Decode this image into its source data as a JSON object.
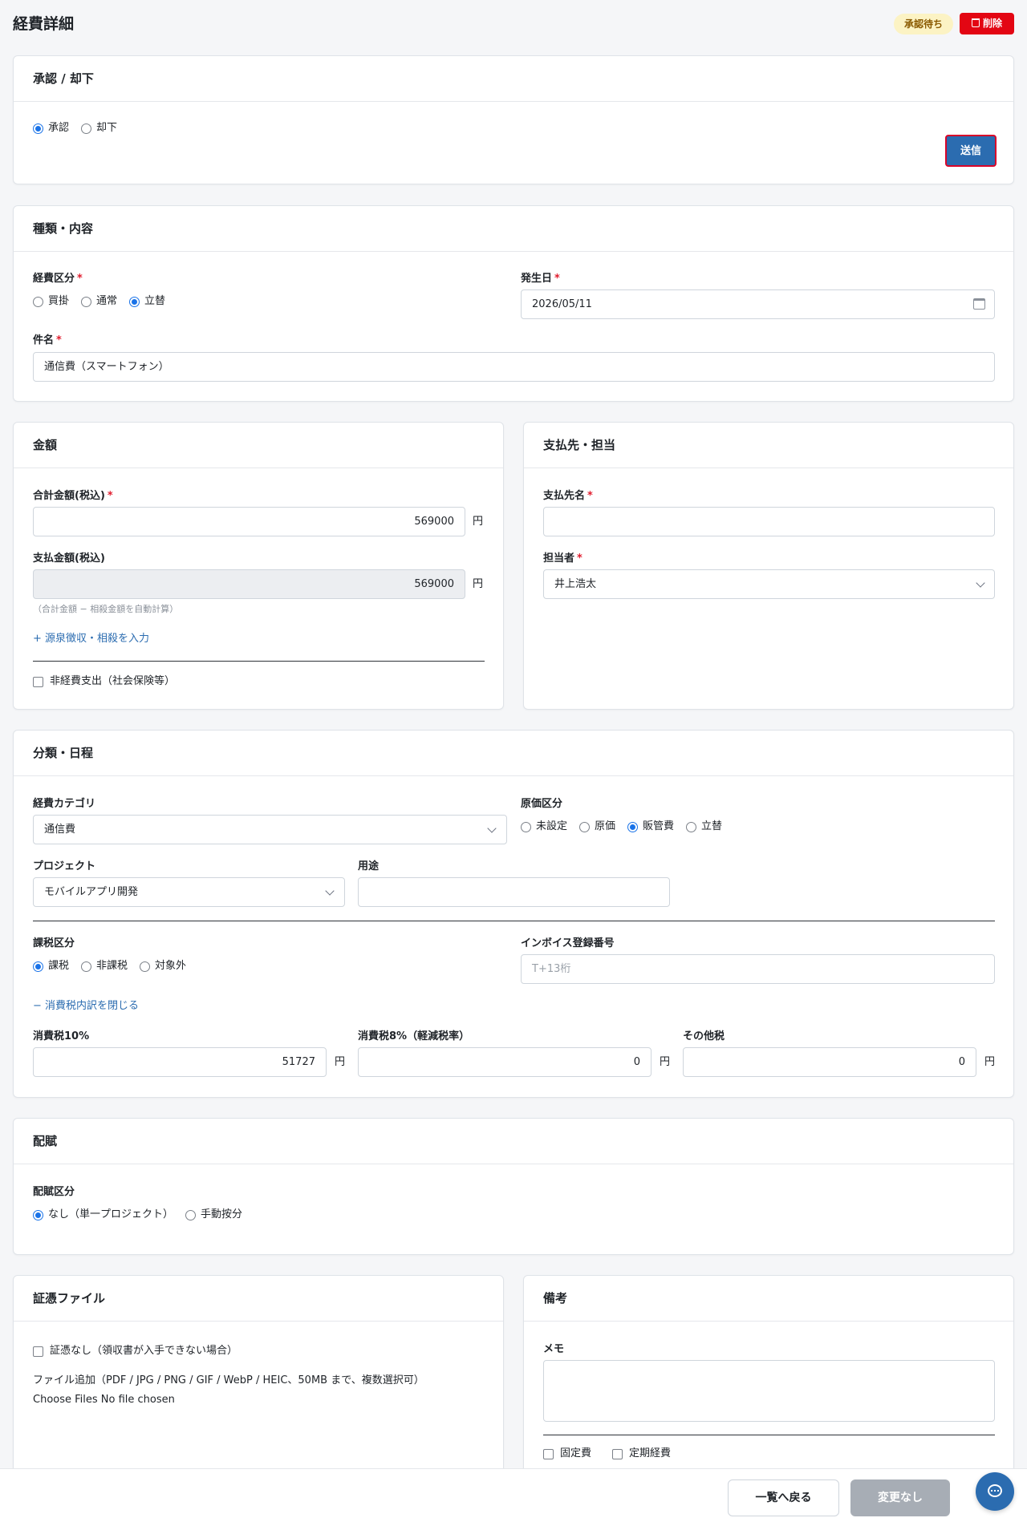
{
  "header": {
    "title": "経費詳細",
    "status_badge": "承認待ち",
    "delete_label": "削除"
  },
  "approval": {
    "title": "承認 / 却下",
    "options": [
      "承認",
      "却下"
    ],
    "send_label": "送信"
  },
  "kind": {
    "title": "種類・内容",
    "expense_type_label": "経費区分",
    "expense_types": [
      "買掛",
      "通常",
      "立替"
    ],
    "date_label": "発生日",
    "date_value": "2026/05/11",
    "subject_label": "件名",
    "subject_value": "通信費（スマートフォン）"
  },
  "amount": {
    "title": "金額",
    "total_label": "合計金額(税込)",
    "total_value": "569000",
    "paid_label": "支払金額(税込)",
    "paid_value": "569000",
    "yen": "円",
    "note": "（合計金額 − 相殺金額を自動計算）",
    "add_link": "+ 源泉徴収・相殺を入力",
    "nonexpense_label": "非経費支出（社会保険等）"
  },
  "payee": {
    "title": "支払先・担当",
    "payee_label": "支払先名",
    "payee_value": "",
    "person_label": "担当者",
    "person_value": "井上浩太"
  },
  "classification": {
    "title": "分類・日程",
    "category_label": "経費カテゴリ",
    "category_value": "通信費",
    "cost_label": "原価区分",
    "cost_options": [
      "未設定",
      "原価",
      "販管費",
      "立替"
    ],
    "project_label": "プロジェクト",
    "project_value": "モバイルアプリ開発",
    "purpose_label": "用途",
    "purpose_value": "",
    "tax_type_label": "課税区分",
    "tax_types": [
      "課税",
      "非課税",
      "対象外"
    ],
    "invoice_label": "インボイス登録番号",
    "invoice_placeholder": "T+13桁",
    "tax_toggle_link": "− 消費税内訳を閉じる",
    "tax10_label": "消費税10%",
    "tax10_value": "51727",
    "tax8_label": "消費税8%（軽減税率）",
    "tax8_value": "0",
    "other_tax_label": "その他税",
    "other_tax_value": "0"
  },
  "allocation": {
    "title": "配賦",
    "type_label": "配賦区分",
    "options": [
      "なし（単一プロジェクト）",
      "手動按分"
    ]
  },
  "evidence": {
    "title": "証憑ファイル",
    "no_evidence_label": "証憑なし（領収書が入手できない場合）",
    "file_add_label": "ファイル追加（PDF / JPG / PNG / GIF / WebP / HEIC、50MB まで、複数選択可）",
    "file_input_text": "Choose Files No file chosen"
  },
  "remarks": {
    "title": "備考",
    "memo_label": "メモ",
    "fixed_cost_label": "固定費",
    "periodic_label": "定期経費"
  },
  "footer": {
    "back_label": "一覧へ戻る",
    "save_label": "変更なし"
  },
  "colors": {
    "primary": "#2b6cb0",
    "danger": "#e30613",
    "badge_bg": "#fcf3c4"
  }
}
